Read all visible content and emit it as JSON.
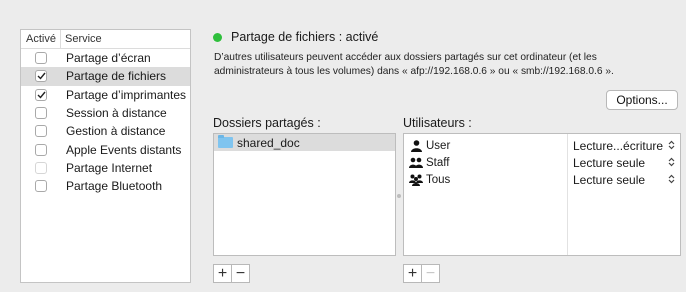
{
  "services": {
    "header_active": "Activé",
    "header_service": "Service",
    "items": [
      {
        "label": "Partage d’écran",
        "checked": false,
        "selected": false,
        "enabled": true
      },
      {
        "label": "Partage de fichiers",
        "checked": true,
        "selected": true,
        "enabled": true
      },
      {
        "label": "Partage d’imprimantes",
        "checked": true,
        "selected": false,
        "enabled": true
      },
      {
        "label": "Session à distance",
        "checked": false,
        "selected": false,
        "enabled": true
      },
      {
        "label": "Gestion à distance",
        "checked": false,
        "selected": false,
        "enabled": true
      },
      {
        "label": "Apple Events distants",
        "checked": false,
        "selected": false,
        "enabled": true
      },
      {
        "label": "Partage Internet",
        "checked": false,
        "selected": false,
        "enabled": false
      },
      {
        "label": "Partage Bluetooth",
        "checked": false,
        "selected": false,
        "enabled": true
      }
    ]
  },
  "status": {
    "title": "Partage de fichiers : activé",
    "color": "#2fbf3c",
    "description": "D’autres utilisateurs peuvent accéder aux dossiers partagés sur cet ordinateur (et les administrateurs à tous les volumes) dans « afp://192.168.0.6 » ou « smb://192.168.0.6 »."
  },
  "options_button": "Options...",
  "folders": {
    "label": "Dossiers partagés :",
    "items": [
      {
        "name": "shared_doc",
        "icon": "folder-icon"
      }
    ]
  },
  "users": {
    "label": "Utilisateurs :",
    "items": [
      {
        "name": "User",
        "icon": "single-user-icon",
        "permission": "Lecture...écriture"
      },
      {
        "name": "Staff",
        "icon": "group-icon",
        "permission": "Lecture seule"
      },
      {
        "name": "Tous",
        "icon": "everyone-icon",
        "permission": "Lecture seule"
      }
    ]
  },
  "buttons": {
    "add": "+",
    "remove": "−",
    "stepper": "⌃⌄"
  }
}
